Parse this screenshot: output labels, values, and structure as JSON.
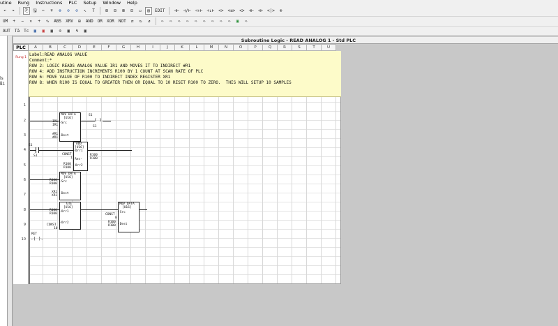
{
  "menu": [
    "utine",
    "Rung",
    "Instructions",
    "PLC",
    "Setup",
    "Window",
    "Help"
  ],
  "toolbar1": [
    "↶",
    "↷",
    "⎘",
    "🖫",
    "✂",
    "♆",
    "⊕",
    "⊖",
    "⊘",
    "↖",
    "T",
    "⊞",
    "⊟",
    "⊠",
    "⊡",
    "▭",
    "▤",
    "EDIT",
    "⊣⊢",
    "⊣/⊢",
    "⊣↑⊢",
    "⊣↓⊢",
    "<>",
    "<≡>",
    "≺≻",
    "⊣⊢",
    "⊣⊢",
    "<|>",
    "⊕"
  ],
  "toolbar2": [
    "UM",
    "+",
    "−",
    "✕",
    "+",
    "∿",
    "ABS",
    "XRV",
    "⊞",
    "AND",
    "OR",
    "XOR",
    "NOT",
    "⇄",
    "↻",
    "↺",
    "⇨",
    "⇨",
    "⇨",
    "⇨",
    "⇨",
    "⇨",
    "⇨",
    "⇨",
    "⇨",
    "▣",
    "⇨"
  ],
  "toolbar3": [
    "AUT",
    "Tā",
    "Tc",
    "▣",
    "▣",
    "▣",
    "⊙",
    "▣",
    "↯",
    "▣"
  ],
  "leftpane": {
    "line1": "ls 1",
    "line2": "k1"
  },
  "window_title": "Subroutine Logic - READ ANALOG 1 - Std PLC",
  "plc_label": "PLC",
  "columns": [
    "A",
    "B",
    "C",
    "D",
    "E",
    "F",
    "G",
    "H",
    "I",
    "J",
    "K",
    "L",
    "M",
    "N",
    "O",
    "P",
    "Q",
    "R",
    "S",
    "T",
    "U"
  ],
  "rung_label": "Rung 1",
  "rung_numbers": [
    "1",
    "2",
    "3",
    "4",
    "5",
    "6",
    "7",
    "8",
    "9",
    "10"
  ],
  "comment_lines": [
    "Label:READ ANALOG VALUE",
    "Comment:*",
    "ROW 2: LOGIC READS ANALOG VALUE IR1 AND MOVES IT TO INDIRECT #R1",
    "ROW 4: ADD INSTRUCTION INCREMENTS R100 BY 1 COUNT AT SCAN RATE OF PLC",
    "ROW 6: MOVE VALUE OF R100 TO INDIRECT INDEX REGISTER XR1",
    "ROW 8: WHEN R100 IS EQUAL TO GREATER THEN OR EQUAL TO 10 RESET R100 TO ZERO.  THIS WILL SETUP 10 SAMPLES"
  ],
  "ladder": {
    "mov1": {
      "title": "MOV DATA",
      "type": "[U16]",
      "src_label": "-Src",
      "src_val": "IR1",
      "src_val2": "IR1",
      "dest_label": "-Dest",
      "dest_val": "#R1",
      "dest_val2": "#R1"
    },
    "coil1": {
      "label": "S1",
      "symbol": "( )",
      "sub": "S1"
    },
    "contact1": {
      "label": "S1",
      "sub": "S1"
    },
    "add": {
      "title": "ADD",
      "type": "[U16]",
      "in1_label": "-Orr1",
      "res_label": "Res-",
      "res_val": "R100",
      "res_val2": "R100",
      "in2_label": "-Orr2",
      "const_label": "CONST",
      "const_val": "1",
      "in2_val": "R100",
      "in2_val2": "R100"
    },
    "mov2": {
      "title": "MOV DATA",
      "type": "[U16]",
      "src_label": "-Src",
      "src_val": "R100",
      "src_val2": "R100",
      "dest_label": "-Dest",
      "dest_val": "XR1",
      "dest_val2": "XR1"
    },
    "gte": {
      "title": "GTE",
      "type": "[U16]",
      "in1_label": "-Orr1",
      "in1_val": "R100",
      "in1_val2": "R100",
      "in2_label": "-Orr2",
      "const_label": "CONST",
      "const_val": "10"
    },
    "mov3": {
      "title": "MOV DATA",
      "type": "[U16]",
      "src_label": "-Src",
      "const_label": "CONST",
      "const_val": "0",
      "dest_label": "-Dest",
      "dest_val": "R100",
      "dest_val2": "R100"
    },
    "ret": {
      "label": "RET",
      "symbol": "-( )-"
    }
  }
}
